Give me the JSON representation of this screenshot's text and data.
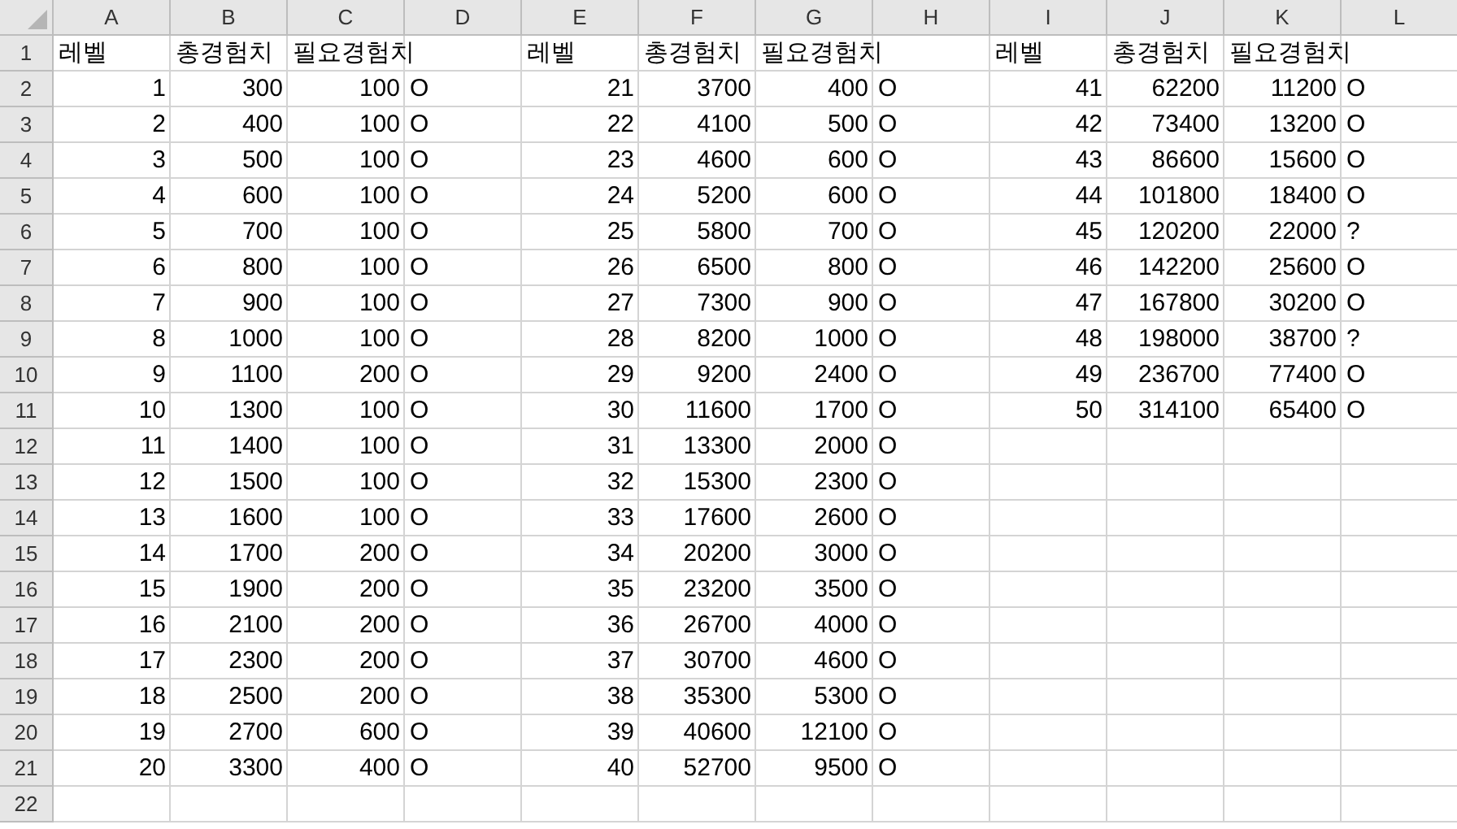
{
  "columns": [
    "A",
    "B",
    "C",
    "D",
    "E",
    "F",
    "G",
    "H",
    "I",
    "J",
    "K",
    "L"
  ],
  "row_numbers": [
    "1",
    "2",
    "3",
    "4",
    "5",
    "6",
    "7",
    "8",
    "9",
    "10",
    "11",
    "12",
    "13",
    "14",
    "15",
    "16",
    "17",
    "18",
    "19",
    "20",
    "21",
    "22"
  ],
  "blocks": [
    {
      "header": [
        "레벨",
        "총경험치",
        "필요경험치"
      ],
      "rows": [
        [
          "1",
          "300",
          "100",
          "O"
        ],
        [
          "2",
          "400",
          "100",
          "O"
        ],
        [
          "3",
          "500",
          "100",
          "O"
        ],
        [
          "4",
          "600",
          "100",
          "O"
        ],
        [
          "5",
          "700",
          "100",
          "O"
        ],
        [
          "6",
          "800",
          "100",
          "O"
        ],
        [
          "7",
          "900",
          "100",
          "O"
        ],
        [
          "8",
          "1000",
          "100",
          "O"
        ],
        [
          "9",
          "1100",
          "200",
          "O"
        ],
        [
          "10",
          "1300",
          "100",
          "O"
        ],
        [
          "11",
          "1400",
          "100",
          "O"
        ],
        [
          "12",
          "1500",
          "100",
          "O"
        ],
        [
          "13",
          "1600",
          "100",
          "O"
        ],
        [
          "14",
          "1700",
          "200",
          "O"
        ],
        [
          "15",
          "1900",
          "200",
          "O"
        ],
        [
          "16",
          "2100",
          "200",
          "O"
        ],
        [
          "17",
          "2300",
          "200",
          "O"
        ],
        [
          "18",
          "2500",
          "200",
          "O"
        ],
        [
          "19",
          "2700",
          "600",
          "O"
        ],
        [
          "20",
          "3300",
          "400",
          "O"
        ]
      ]
    },
    {
      "header": [
        "레벨",
        "총경험치",
        "필요경험치"
      ],
      "rows": [
        [
          "21",
          "3700",
          "400",
          "O"
        ],
        [
          "22",
          "4100",
          "500",
          "O"
        ],
        [
          "23",
          "4600",
          "600",
          "O"
        ],
        [
          "24",
          "5200",
          "600",
          "O"
        ],
        [
          "25",
          "5800",
          "700",
          "O"
        ],
        [
          "26",
          "6500",
          "800",
          "O"
        ],
        [
          "27",
          "7300",
          "900",
          "O"
        ],
        [
          "28",
          "8200",
          "1000",
          "O"
        ],
        [
          "29",
          "9200",
          "2400",
          "O"
        ],
        [
          "30",
          "11600",
          "1700",
          "O"
        ],
        [
          "31",
          "13300",
          "2000",
          "O"
        ],
        [
          "32",
          "15300",
          "2300",
          "O"
        ],
        [
          "33",
          "17600",
          "2600",
          "O"
        ],
        [
          "34",
          "20200",
          "3000",
          "O"
        ],
        [
          "35",
          "23200",
          "3500",
          "O"
        ],
        [
          "36",
          "26700",
          "4000",
          "O"
        ],
        [
          "37",
          "30700",
          "4600",
          "O"
        ],
        [
          "38",
          "35300",
          "5300",
          "O"
        ],
        [
          "39",
          "40600",
          "12100",
          "O"
        ],
        [
          "40",
          "52700",
          "9500",
          "O"
        ]
      ]
    },
    {
      "header": [
        "레벨",
        "총경험치",
        "필요경험치"
      ],
      "rows": [
        [
          "41",
          "62200",
          "11200",
          "O"
        ],
        [
          "42",
          "73400",
          "13200",
          "O"
        ],
        [
          "43",
          "86600",
          "15600",
          "O"
        ],
        [
          "44",
          "101800",
          "18400",
          "O"
        ],
        [
          "45",
          "120200",
          "22000",
          "?"
        ],
        [
          "46",
          "142200",
          "25600",
          "O"
        ],
        [
          "47",
          "167800",
          "30200",
          "O"
        ],
        [
          "48",
          "198000",
          "38700",
          "?"
        ],
        [
          "49",
          "236700",
          "77400",
          "O"
        ],
        [
          "50",
          "314100",
          "65400",
          "O"
        ]
      ]
    }
  ]
}
